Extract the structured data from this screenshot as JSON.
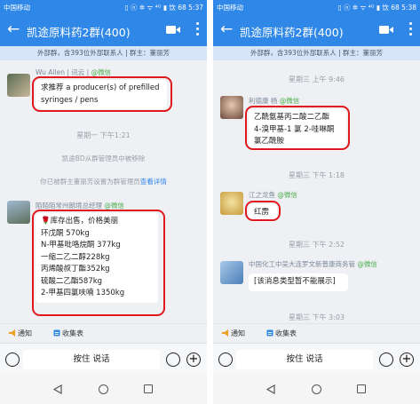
{
  "colors": {
    "accent": "#2f87e8",
    "highlight": "#e0191f",
    "wechat": "#4cae4c"
  },
  "left": {
    "status": {
      "carrier": "中国移动",
      "system": "▯ ⓝ ✲ ᯤ ⁴ᴳ ▮ 饮 68 5:37"
    },
    "title": "凯途原料药2群(400)",
    "subbar": "外部群，含393位外部联系人 | 群主：董丽芳",
    "messages": {
      "m1": {
        "sender": "Wu Allen | 讯云 |",
        "wx": "@微信",
        "lines": [
          "求推荐 a producer(s) of prefilled",
          "syringes / pens"
        ]
      },
      "time1": "星期一 下午1:21",
      "sys1": "凯途BD从群管理员中被移除",
      "sys2_text": "你已被群主董丽芳设置为群管理员",
      "sys2_link": "查看详情",
      "m2": {
        "sender": "陌陌陌常州朗境总经理",
        "wx": "@微信",
        "lines": [
          "🌹库存出售，价格美丽",
          "环戊酮 570kg",
          "N-甲基吡咯烷酮 377kg",
          "一缩二乙二醇228kg",
          "丙烯酸叔丁酯352kg",
          "硫酸二乙酯587kg",
          "2-甲基四氯呋喃 1350kg"
        ]
      }
    },
    "toolbar": {
      "notice": "通知",
      "collect": "收集表"
    },
    "input": {
      "hold_label": "按住 说话"
    }
  },
  "right": {
    "status": {
      "carrier": "中国移动",
      "system": "▯ ⓝ ✲ ᯤ ⁴ᴳ ▮ 饮 68 5:38"
    },
    "title": "凯途原料药2群(400)",
    "subbar": "外部群，含393位外部联系人 | 群主：董丽芳",
    "messages": {
      "time_top": "星期三 上午 9:46",
      "m1": {
        "sender": "利德康 杨",
        "wx": "@微信",
        "lines": [
          "乙酰氨基丙二酸二乙酯",
          "4-溴甲基-1 氯 2-哇啉酮",
          "氯乙酰胺"
        ]
      },
      "time1": "星期三 下午 1:18",
      "m2": {
        "sender": "江之龙鱼",
        "wx": "@微信",
        "lines": [
          "红雳"
        ]
      },
      "time2": "星期三 下午 2:52",
      "m3": {
        "sender": "中国化工中吴大连罗文新普康商务管",
        "wx": "@微信",
        "lines": [
          "[该消息类型暂不能展示]"
        ]
      },
      "time3": "星期三 下午 3:03"
    },
    "toolbar": {
      "notice": "通知",
      "collect": "收集表"
    },
    "input": {
      "hold_label": "按住 说话"
    }
  }
}
